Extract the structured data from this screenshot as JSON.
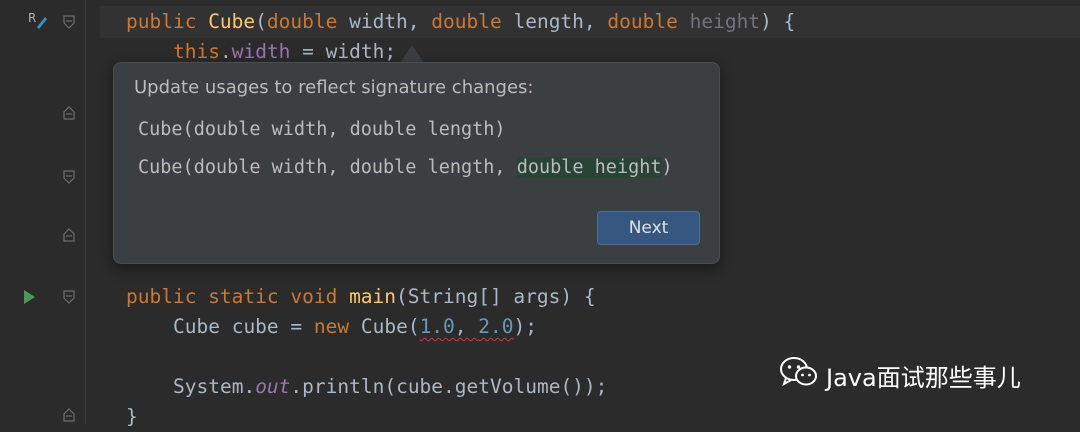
{
  "editor": {
    "lines": {
      "l1": {
        "kw1": "public ",
        "ctor": "Cube",
        "p1": "(",
        "kw2": "double",
        "p2": " width, ",
        "kw3": "double",
        "p3": " length, ",
        "kw4": "double",
        "p4": " ",
        "unused": "height",
        "p5": ") {"
      },
      "l2": {
        "kw": "this",
        "dot": ".",
        "field": "width",
        "rest": " = width;"
      },
      "l3": {
        "kw1": "public static void ",
        "fn": "main",
        "rest": "(String[] args) {"
      },
      "l4": {
        "a": "Cube cube = ",
        "kw": "new ",
        "b": "Cube(",
        "n1": "1.0",
        "c": ", ",
        "n2": "2.0",
        "d": ");"
      },
      "l5": {
        "a": "System.",
        "out": "out",
        "b": ".println(cube.getVolume());"
      },
      "l6": {
        "brace": "}"
      }
    }
  },
  "popup": {
    "title": "Update usages to reflect signature changes:",
    "old_signature": "Cube(double width, double length)",
    "new_signature_prefix": "Cube(double width, double length, ",
    "new_signature_added": "double height",
    "new_signature_suffix": ")",
    "next_label": "Next"
  },
  "gutter": {
    "refactor_badge": "R"
  },
  "watermark": {
    "text": "Java面试那些事儿"
  },
  "colors": {
    "background": "#2b2b2b",
    "keyword": "#cc7832",
    "function": "#ffc66d",
    "field": "#9876aa",
    "number": "#6897bb",
    "button": "#365880",
    "added_highlight": "#294436"
  }
}
